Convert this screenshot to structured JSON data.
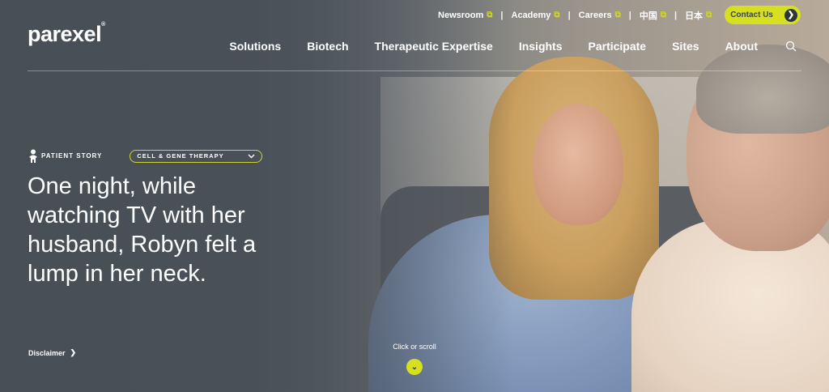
{
  "brand": {
    "logo_text": "parexel",
    "accent_color": "#d6e021",
    "overlay_color": "#484e56"
  },
  "utility_nav": {
    "items": [
      {
        "label": "Newsroom",
        "icon": "external-link-icon"
      },
      {
        "label": "Academy",
        "icon": "external-link-icon"
      },
      {
        "label": "Careers",
        "icon": "external-link-icon"
      },
      {
        "label": "中国",
        "icon": "external-link-icon"
      },
      {
        "label": "日本",
        "icon": "external-link-icon"
      }
    ],
    "contact_label": "Contact Us",
    "contact_icon": "chevron-right-icon"
  },
  "main_nav": {
    "items": [
      "Solutions",
      "Biotech",
      "Therapeutic Expertise",
      "Insights",
      "Participate",
      "Sites",
      "About"
    ],
    "search_icon": "search-icon"
  },
  "hero": {
    "eyebrow": "PATIENT STORY",
    "eyebrow_icon": "person-icon",
    "category_select": "CELL & GENE THERAPY",
    "headline": "One night, while watching TV with her husband, Robyn felt a lump in her neck.",
    "disclaimer": "Disclaimer",
    "scroll_hint": "Click or scroll",
    "scroll_icon": "chevron-down-icon"
  }
}
